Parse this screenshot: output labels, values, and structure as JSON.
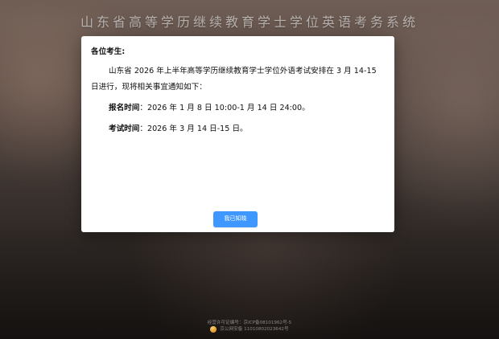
{
  "header": {
    "title": "山东省高等学历继续教育学士学位英语考务系统"
  },
  "notice": {
    "greeting": "各位考生:",
    "paragraph": "山东省 2026 年上半年高等学历继续教育学士学位外语考试安排在 3 月 14-15 日进行，现将相关事宜通知如下：",
    "items": [
      {
        "label": "报名时间",
        "value": "：2026 年 1 月 8 日 10:00-1 月 14 日 24:00。"
      },
      {
        "label": "考试时间",
        "value": "：2026 年 3 月 14 日-15 日。"
      }
    ],
    "confirm_label": "我已知晓"
  },
  "footer": {
    "line1": "经营许可证编号：京ICP备08101962号-5",
    "line2": "京公网安备 11010802023642号",
    "icon": "police-badge-icon"
  }
}
